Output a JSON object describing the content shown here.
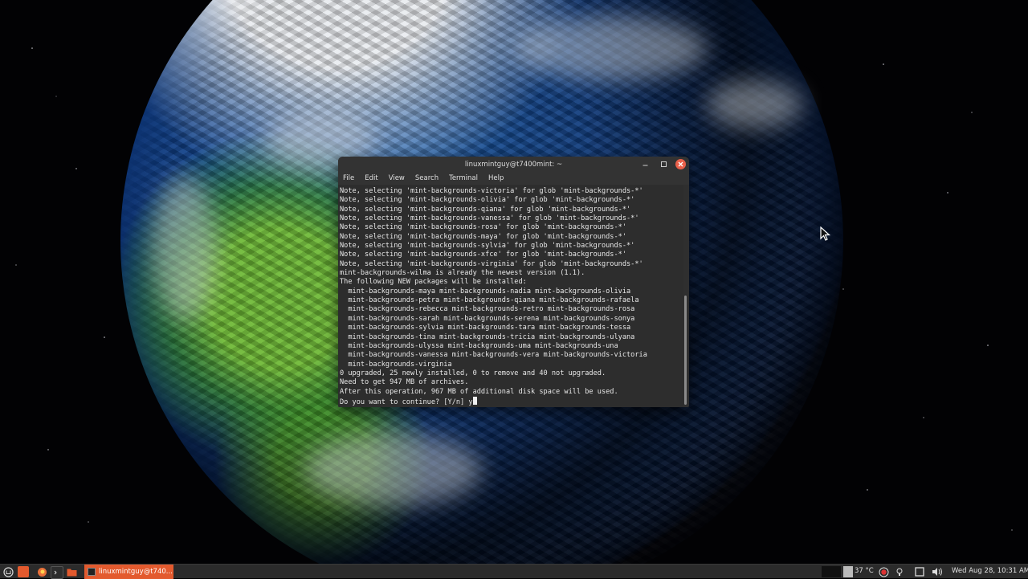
{
  "window": {
    "title": "linuxmintguy@t7400mint: ~",
    "menu": [
      "File",
      "Edit",
      "View",
      "Search",
      "Terminal",
      "Help"
    ],
    "controls": {
      "minimize": "–",
      "maximize": "□",
      "close": "✕"
    }
  },
  "terminal": {
    "lines": [
      "Note, selecting 'mint-backgrounds-victoria' for glob 'mint-backgrounds-*'",
      "Note, selecting 'mint-backgrounds-olivia' for glob 'mint-backgrounds-*'",
      "Note, selecting 'mint-backgrounds-qiana' for glob 'mint-backgrounds-*'",
      "Note, selecting 'mint-backgrounds-vanessa' for glob 'mint-backgrounds-*'",
      "Note, selecting 'mint-backgrounds-rosa' for glob 'mint-backgrounds-*'",
      "Note, selecting 'mint-backgrounds-maya' for glob 'mint-backgrounds-*'",
      "Note, selecting 'mint-backgrounds-sylvia' for glob 'mint-backgrounds-*'",
      "Note, selecting 'mint-backgrounds-xfce' for glob 'mint-backgrounds-*'",
      "Note, selecting 'mint-backgrounds-virginia' for glob 'mint-backgrounds-*'",
      "mint-backgrounds-wilma is already the newest version (1.1).",
      "The following NEW packages will be installed:",
      "  mint-backgrounds-maya mint-backgrounds-nadia mint-backgrounds-olivia",
      "  mint-backgrounds-petra mint-backgrounds-qiana mint-backgrounds-rafaela",
      "  mint-backgrounds-rebecca mint-backgrounds-retro mint-backgrounds-rosa",
      "  mint-backgrounds-sarah mint-backgrounds-serena mint-backgrounds-sonya",
      "  mint-backgrounds-sylvia mint-backgrounds-tara mint-backgrounds-tessa",
      "  mint-backgrounds-tina mint-backgrounds-tricia mint-backgrounds-ulyana",
      "  mint-backgrounds-ulyssa mint-backgrounds-uma mint-backgrounds-una",
      "  mint-backgrounds-vanessa mint-backgrounds-vera mint-backgrounds-victoria",
      "  mint-backgrounds-virginia",
      "0 upgraded, 25 newly installed, 0 to remove and 40 not upgraded.",
      "Need to get 947 MB of archives.",
      "After this operation, 967 MB of additional disk space will be used."
    ],
    "prompt": "Do you want to continue? [Y/n] ",
    "input": "y"
  },
  "taskbar": {
    "launchers": [
      "menu-icon",
      "show-desktop-icon",
      "firefox-icon",
      "terminal-icon",
      "files-icon"
    ],
    "task_label": "linuxmintguy@t740...",
    "temperature": "37 °C",
    "clock": "Wed Aug 28, 10:31 AM",
    "tray_icons": [
      "workspace-icon",
      "cpu-graph-icon",
      "temperature-icon",
      "update-manager-icon",
      "network-icon",
      "display-icon",
      "volume-icon"
    ]
  },
  "colors": {
    "accent": "#e35a2e",
    "close_button": "#e9604a",
    "terminal_bg": "#2d2d2d",
    "terminal_fg": "#e8e8e8",
    "panel_bg": "#2b2b2b"
  }
}
